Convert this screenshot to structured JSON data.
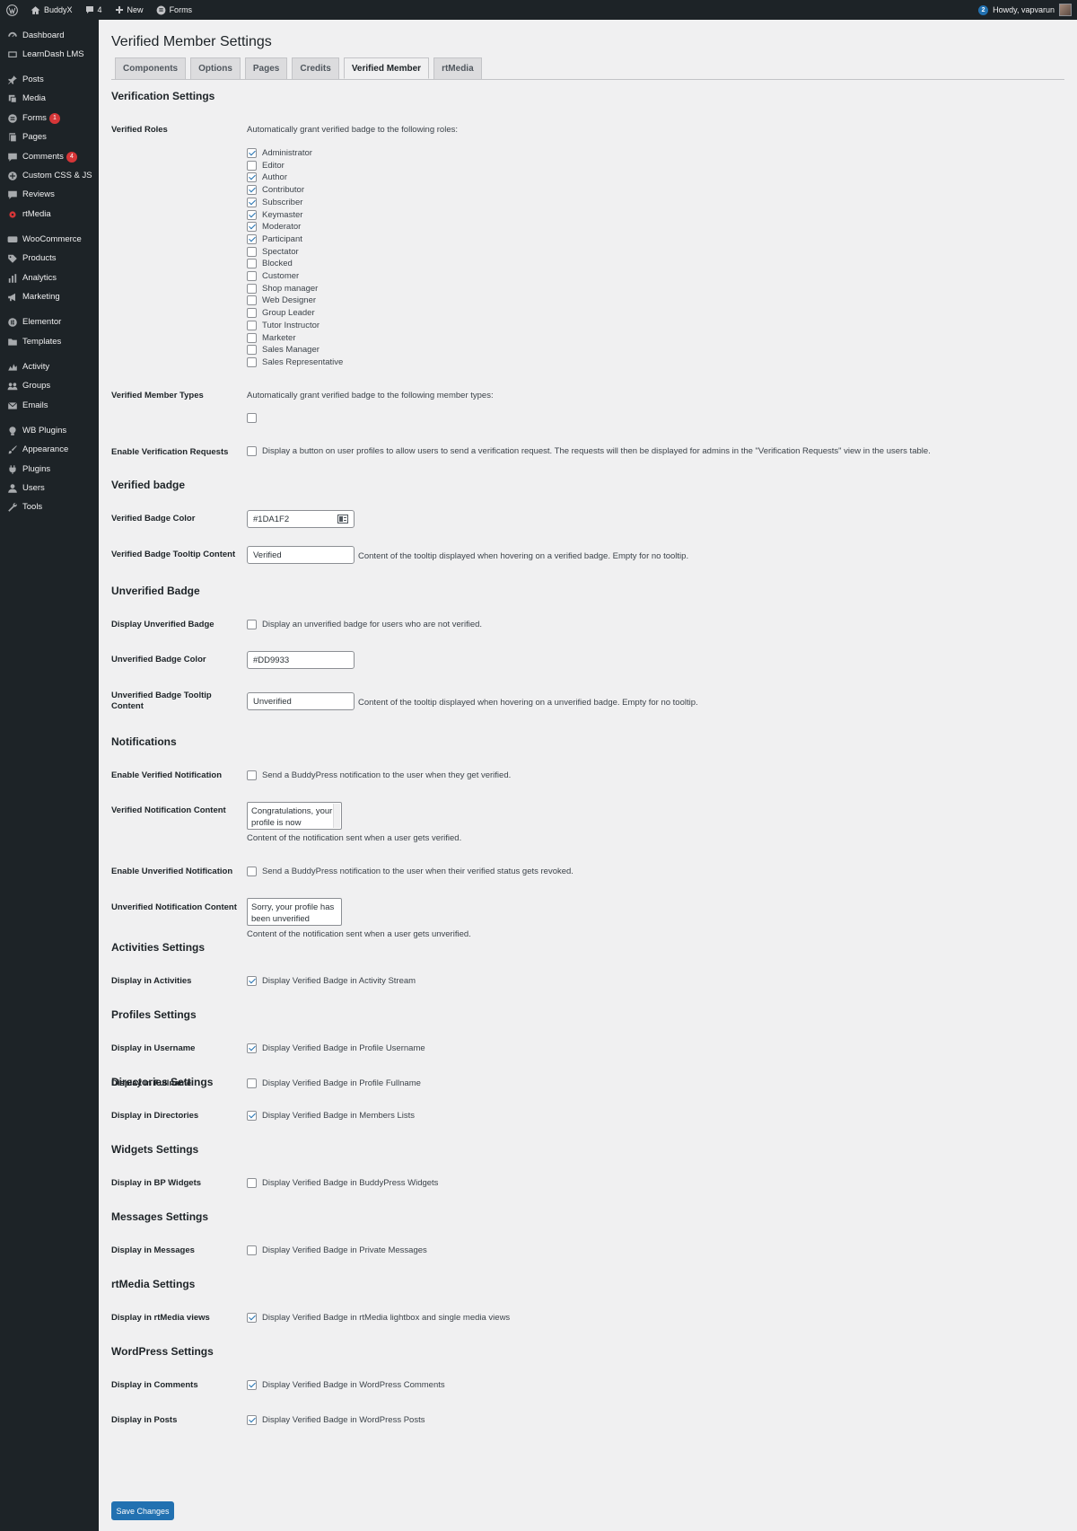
{
  "adminbar": {
    "site_name": "BuddyX",
    "comments_count": "4",
    "new_label": "New",
    "forms_label": "Forms",
    "notif_count": "2",
    "howdy": "Howdy, vapvarun"
  },
  "sidebar": {
    "items": [
      {
        "label": "Dashboard",
        "icon": "dashboard-icon"
      },
      {
        "label": "LearnDash LMS",
        "icon": "learndash-icon"
      },
      {
        "label": "Posts",
        "icon": "pin-icon"
      },
      {
        "label": "Media",
        "icon": "media-icon"
      },
      {
        "label": "Forms",
        "icon": "forms-icon",
        "badge": "1"
      },
      {
        "label": "Pages",
        "icon": "pages-icon"
      },
      {
        "label": "Comments",
        "icon": "comments-icon",
        "badge": "4"
      },
      {
        "label": "Custom CSS & JS",
        "icon": "plus-circle-icon"
      },
      {
        "label": "Reviews",
        "icon": "reviews-icon"
      },
      {
        "label": "rtMedia",
        "icon": "rtmedia-icon"
      },
      {
        "label": "WooCommerce",
        "icon": "woocommerce-icon"
      },
      {
        "label": "Products",
        "icon": "products-icon"
      },
      {
        "label": "Analytics",
        "icon": "analytics-icon"
      },
      {
        "label": "Marketing",
        "icon": "megaphone-icon"
      },
      {
        "label": "Elementor",
        "icon": "elementor-icon"
      },
      {
        "label": "Templates",
        "icon": "folder-icon"
      },
      {
        "label": "Activity",
        "icon": "activity-icon"
      },
      {
        "label": "Groups",
        "icon": "groups-icon"
      },
      {
        "label": "Emails",
        "icon": "email-icon"
      },
      {
        "label": "WB Plugins",
        "icon": "bulb-icon"
      },
      {
        "label": "Appearance",
        "icon": "brush-icon"
      },
      {
        "label": "Plugins",
        "icon": "plugin-icon"
      },
      {
        "label": "Users",
        "icon": "users-icon"
      },
      {
        "label": "Tools",
        "icon": "wrench-icon"
      }
    ]
  },
  "page": {
    "title": "Verified Member Settings",
    "tabs": [
      "Components",
      "Options",
      "Pages",
      "Credits",
      "Verified Member",
      "rtMedia"
    ],
    "active_tab": "Verified Member"
  },
  "verification": {
    "heading": "Verification Settings",
    "roles_label": "Verified Roles",
    "roles_desc": "Automatically grant verified badge to the following roles:",
    "roles": [
      {
        "name": "Administrator",
        "checked": true
      },
      {
        "name": "Editor",
        "checked": false
      },
      {
        "name": "Author",
        "checked": true
      },
      {
        "name": "Contributor",
        "checked": true
      },
      {
        "name": "Subscriber",
        "checked": true
      },
      {
        "name": "Keymaster",
        "checked": true
      },
      {
        "name": "Moderator",
        "checked": true
      },
      {
        "name": "Participant",
        "checked": true
      },
      {
        "name": "Spectator",
        "checked": false
      },
      {
        "name": "Blocked",
        "checked": false
      },
      {
        "name": "Customer",
        "checked": false
      },
      {
        "name": "Shop manager",
        "checked": false
      },
      {
        "name": "Web Designer",
        "checked": false
      },
      {
        "name": "Group Leader",
        "checked": false
      },
      {
        "name": "Tutor Instructor",
        "checked": false
      },
      {
        "name": "Marketer",
        "checked": false
      },
      {
        "name": "Sales Manager",
        "checked": false
      },
      {
        "name": "Sales Representative",
        "checked": false
      }
    ],
    "member_types_label": "Verified Member Types",
    "member_types_desc": "Automatically grant verified badge to the following member types:",
    "requests_label": "Enable Verification Requests",
    "requests_desc": "Display a button on user profiles to allow users to send a verification request. The requests will then be displayed for admins in the \"Verification Requests\" view in the users table."
  },
  "verified_badge": {
    "heading": "Verified badge",
    "color_label": "Verified Badge Color",
    "color_value": "#1DA1F2",
    "tooltip_label": "Verified Badge Tooltip Content",
    "tooltip_value": "Verified",
    "tooltip_desc": "Content of the tooltip displayed when hovering on a verified badge. Empty for no tooltip."
  },
  "unverified_badge": {
    "heading": "Unverified Badge",
    "display_label": "Display Unverified Badge",
    "display_desc": "Display an unverified badge for users who are not verified.",
    "color_label": "Unverified Badge Color",
    "color_value": "#DD9933",
    "tooltip_label_1": "Unverified Badge Tooltip",
    "tooltip_label_2": "Content",
    "tooltip_value": "Unverified",
    "tooltip_desc": "Content of the tooltip displayed when hovering on a unverified badge. Empty for no tooltip."
  },
  "notifications": {
    "heading": "Notifications",
    "enable_verified_label": "Enable Verified Notification",
    "enable_verified_desc": "Send a BuddyPress notification to the user when they get verified.",
    "verified_content_label": "Verified Notification Content",
    "verified_content_value": "Congratulations, your profile is now",
    "verified_content_desc": "Content of the notification sent when a user gets verified.",
    "enable_unverified_label": "Enable Unverified Notification",
    "enable_unverified_desc": "Send a BuddyPress notification to the user when their verified status gets revoked.",
    "unverified_content_label": "Unverified Notification Content",
    "unverified_content_value": "Sorry, your profile has been unverified",
    "unverified_content_desc": "Content of the notification sent when a user gets unverified."
  },
  "sections": [
    {
      "heading": "Activities Settings",
      "rows": [
        {
          "label": "Display in Activities",
          "desc": "Display Verified Badge in Activity Stream",
          "checked": true
        }
      ]
    },
    {
      "heading": "Profiles Settings",
      "rows": [
        {
          "label": "Display in Username",
          "desc": "Display Verified Badge in Profile Username",
          "checked": true
        },
        {
          "label": "Display in Fullname",
          "desc": "Display Verified Badge in Profile Fullname",
          "checked": false
        }
      ]
    },
    {
      "heading": "Directories Settings",
      "rows": [
        {
          "label": "Display in Directories",
          "desc": "Display Verified Badge in Members Lists",
          "checked": true
        }
      ]
    },
    {
      "heading": "Widgets Settings",
      "rows": [
        {
          "label": "Display in BP Widgets",
          "desc": "Display Verified Badge in BuddyPress Widgets",
          "checked": false
        }
      ]
    },
    {
      "heading": "Messages Settings",
      "rows": [
        {
          "label": "Display in Messages",
          "desc": "Display Verified Badge in Private Messages",
          "checked": false
        }
      ]
    },
    {
      "heading": "rtMedia Settings",
      "rows": [
        {
          "label": "Display in rtMedia views",
          "desc": "Display Verified Badge in rtMedia lightbox and single media views",
          "checked": true
        }
      ]
    },
    {
      "heading": "WordPress Settings",
      "rows": [
        {
          "label": "Display in Comments",
          "desc": "Display Verified Badge in WordPress Comments",
          "checked": true
        },
        {
          "label": "Display in Posts",
          "desc": "Display Verified Badge in WordPress Posts",
          "checked": true
        }
      ]
    }
  ],
  "save_label": "Save Changes"
}
